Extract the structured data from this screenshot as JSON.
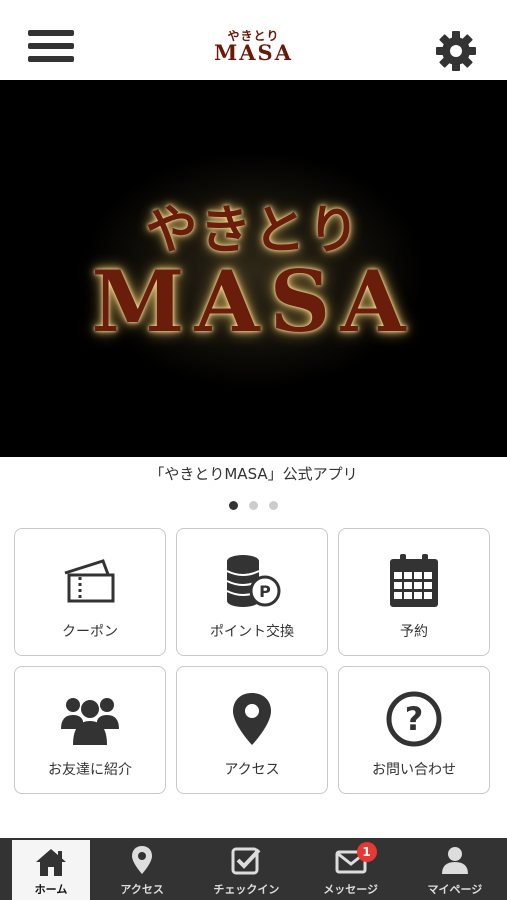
{
  "header": {
    "logo_line1": "やきとり",
    "logo_line2": "MASA"
  },
  "hero": {
    "line1": "やきとり",
    "line2": "MASA"
  },
  "carousel": {
    "caption": "「やきとりMASA」公式アプリ",
    "slide_count": 3,
    "active_index": 0
  },
  "tiles": [
    {
      "label": "クーポン",
      "icon": "coupon-icon"
    },
    {
      "label": "ポイント交換",
      "icon": "point-coins-icon"
    },
    {
      "label": "予約",
      "icon": "calendar-icon"
    },
    {
      "label": "お友達に紹介",
      "icon": "group-icon"
    },
    {
      "label": "アクセス",
      "icon": "map-pin-icon"
    },
    {
      "label": "お問い合わせ",
      "icon": "question-icon"
    }
  ],
  "tabbar": [
    {
      "label": "ホーム",
      "icon": "home-icon"
    },
    {
      "label": "アクセス",
      "icon": "map-pin-icon"
    },
    {
      "label": "チェックイン",
      "icon": "checkin-icon"
    },
    {
      "label": "メッセージ",
      "icon": "mail-icon",
      "badge": "1"
    },
    {
      "label": "マイページ",
      "icon": "user-icon"
    }
  ],
  "colors": {
    "accent_dark": "#333333",
    "brand_brown": "#6a1d0a",
    "badge_red": "#e53935",
    "battery_green": "#4cd964"
  }
}
